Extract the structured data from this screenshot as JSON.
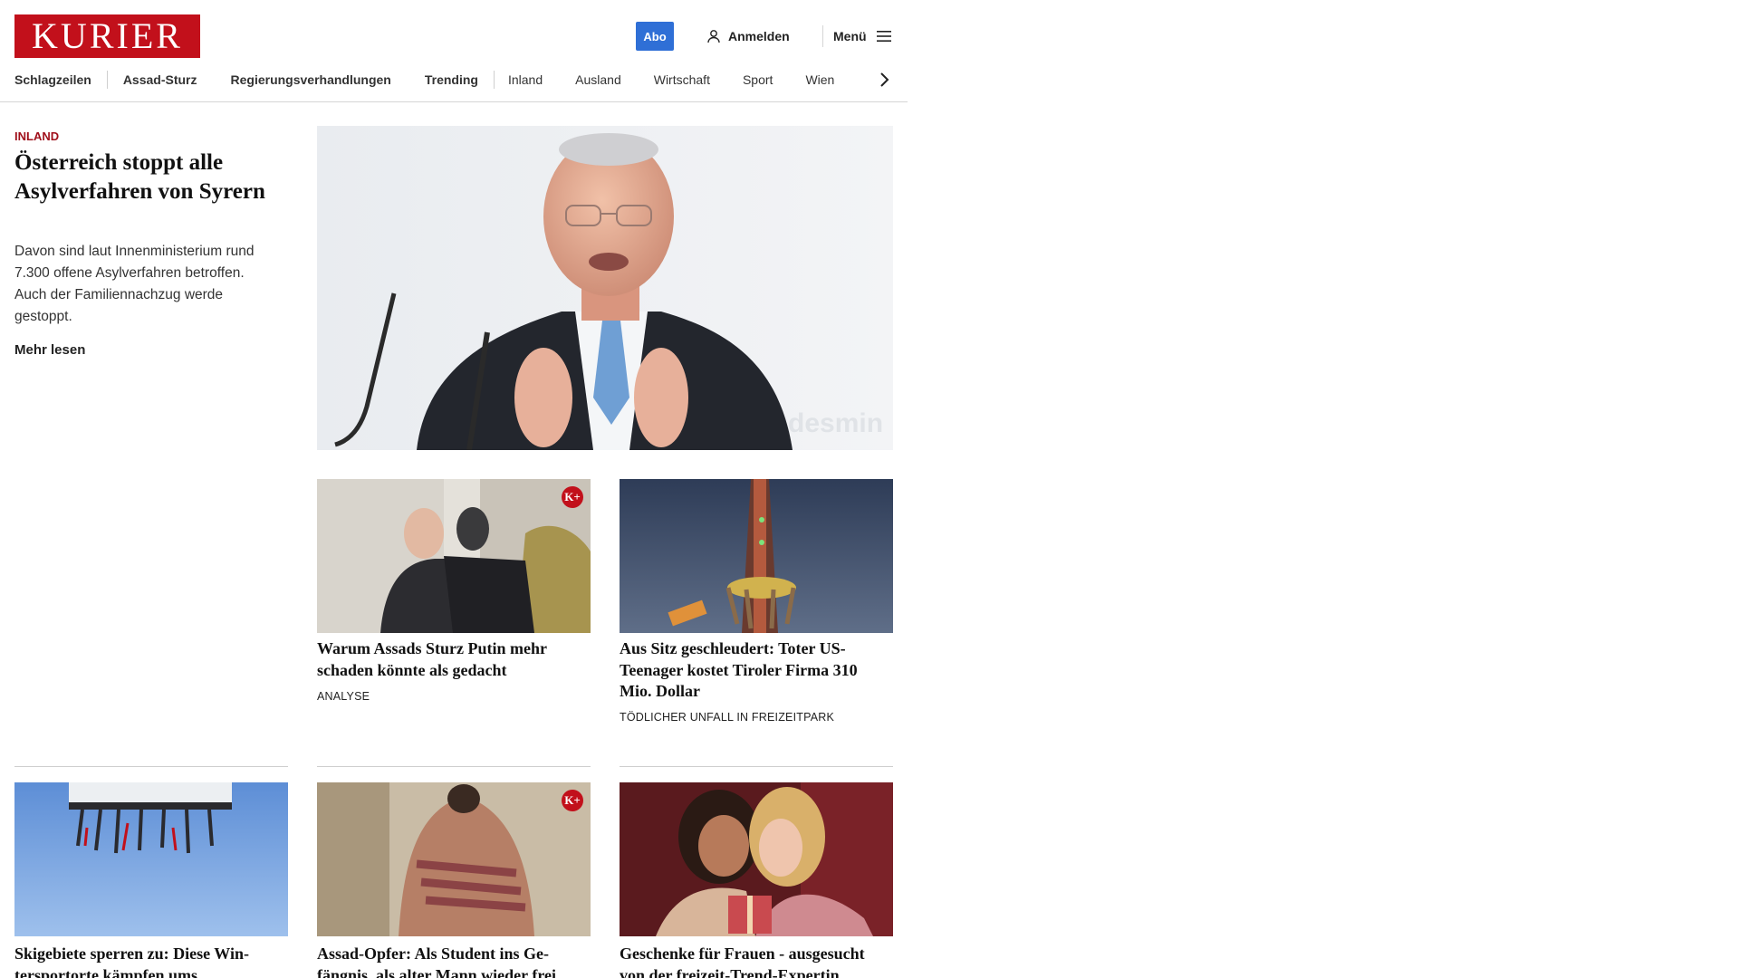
{
  "header": {
    "logo_text": "KURIER",
    "abo_label": "Abo",
    "login_label": "Anmelden",
    "menu_label": "Menü"
  },
  "nav": {
    "items": [
      "Schlagzeilen",
      "Assad-Sturz",
      "Regierungsverhandlungen",
      "Trending",
      "Inland",
      "Ausland",
      "Wirtschaft",
      "Sport",
      "Wien"
    ]
  },
  "lead": {
    "category": "INLAND",
    "title": "Österreich stoppt alle Asylverfahren von Syrern",
    "teaser": "Davon sind laut Innenministerium rund 7.300 offene Asylverfahren betroffen. Auch der Familiennachzug werde gestoppt.",
    "more_label": "Mehr lesen",
    "image_watermark": "desmin"
  },
  "cards": [
    {
      "title": "Warum Assads Sturz Putin mehr schaden könnte als gedacht",
      "kicker": "ANALYSE",
      "kplus": "K+"
    },
    {
      "title": "Aus Sitz geschleudert: Toter US-Teenager kostet Tiroler Firma 310 Mio. Dollar",
      "kicker": "TÖDLICHER UNFALL IN FREIZEITPARK"
    },
    {
      "title": "Skigebiete sperren zu: Diese Win­tersportorte kämpfen ums"
    },
    {
      "title": "Assad-Opfer: Als Student ins Ge­fängnis, als alter Mann wieder frei",
      "kplus": "K+"
    },
    {
      "title": "Geschenke für Frauen - ausgesucht von der freizeit-Trend-Expertin"
    }
  ],
  "colors": {
    "brand": "#c2101b",
    "abo": "#2f6fd6",
    "category": "#a0101b"
  },
  "icons": {
    "login": "user-icon",
    "menu": "hamburger-icon",
    "nav_next": "chevron-right-icon"
  }
}
